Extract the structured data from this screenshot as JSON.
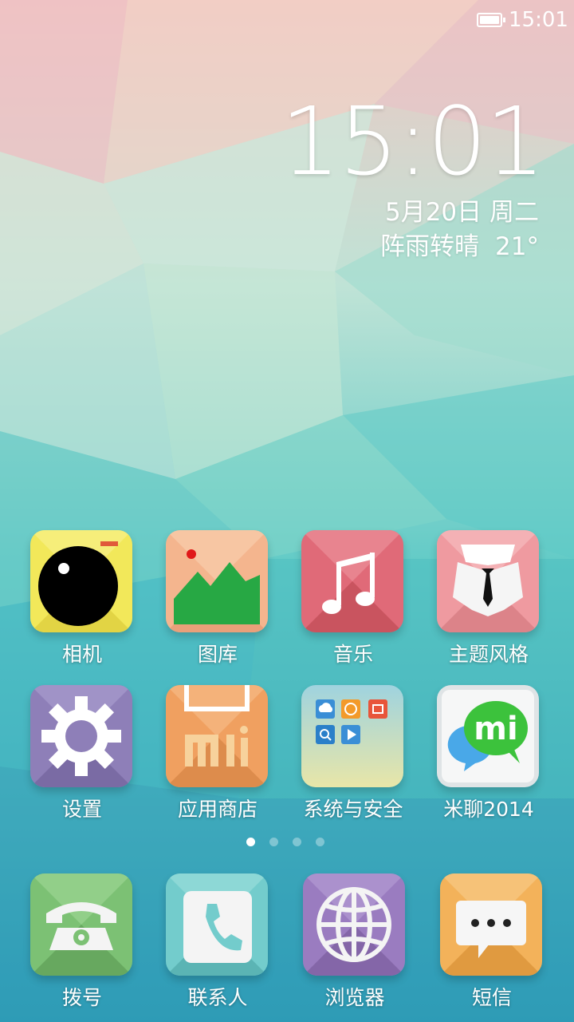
{
  "status_bar": {
    "time": "15:01",
    "battery_icon": "battery-icon"
  },
  "clock_widget": {
    "time": "15:01",
    "date": "5月20日 周二",
    "weather": "阵雨转晴",
    "temperature": "21°"
  },
  "apps": [
    {
      "label": "相机",
      "icon": "camera-icon"
    },
    {
      "label": "图库",
      "icon": "gallery-icon"
    },
    {
      "label": "音乐",
      "icon": "music-icon"
    },
    {
      "label": "主题风格",
      "icon": "theme-icon"
    },
    {
      "label": "设置",
      "icon": "settings-icon"
    },
    {
      "label": "应用商店",
      "icon": "app-store-icon"
    },
    {
      "label": "系统与安全",
      "icon": "system-security-folder-icon"
    },
    {
      "label": "米聊2014",
      "icon": "miliao-icon"
    }
  ],
  "page_indicator": {
    "pages": 4,
    "current": 1
  },
  "dock": [
    {
      "label": "拨号",
      "icon": "phone-icon"
    },
    {
      "label": "联系人",
      "icon": "contacts-icon"
    },
    {
      "label": "浏览器",
      "icon": "browser-icon"
    },
    {
      "label": "短信",
      "icon": "messages-icon"
    }
  ],
  "folder_mini_icons": {
    "cloud": "cloud-icon",
    "mi_a": "mi-icon",
    "mi_b": "mi-icon",
    "search": "search-icon",
    "play": "play-icon"
  },
  "colors": {
    "camera": "#f2e85a",
    "gallery": "#f4b58e",
    "music": "#e06a78",
    "theme": "#ef9aa0",
    "settings": "#8e7fb8",
    "store": "#f0a060",
    "miliao_green": "#3cc23c",
    "phone": "#7cc174",
    "contacts": "#73cccc",
    "browser": "#9a7cc0",
    "messages": "#f3b25a"
  }
}
